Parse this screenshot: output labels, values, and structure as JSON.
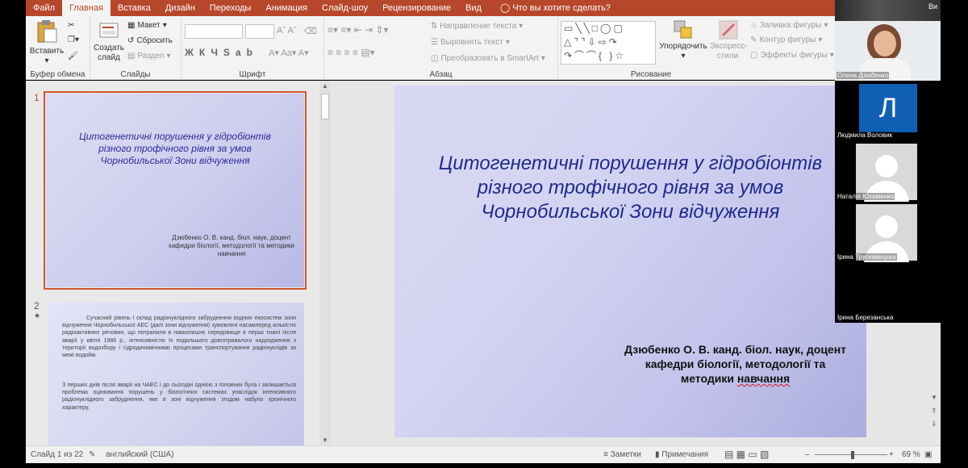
{
  "ribbon_tabs": [
    "Файл",
    "Главная",
    "Вставка",
    "Дизайн",
    "Переходы",
    "Анимация",
    "Слайд-шоу",
    "Рецензирование",
    "Вид"
  ],
  "tell_me": "Что вы хотите сделать?",
  "clipboard": {
    "paste": "Вставить",
    "label": "Буфер обмена"
  },
  "slides_group": {
    "create": "Создать",
    "slide": "слайд",
    "layout": "Макет",
    "reset": "Сбросить",
    "section": "Раздел",
    "label": "Слайды"
  },
  "font_group": {
    "label": "Шрифт",
    "format_chars": "ЖКЧSab"
  },
  "paragraph_group": {
    "text_direction": "Направление текста",
    "align_text": "Выровнять текст",
    "smartart": "Преобразовать в SmartArt",
    "label": "Абзац"
  },
  "drawing_group": {
    "arrange": "Упорядочить",
    "styles_1": "Экспресс-",
    "styles_2": "стили",
    "fill": "Заливка фигуры",
    "outline": "Контур фигуры",
    "effects": "Эффекты фигуры",
    "label": "Рисование"
  },
  "slides": [
    {
      "number": "1",
      "title": "Цитогенетичні порушення у гідробіонтів різного трофічного рівня за умов Чорнобильської Зони відчуження",
      "author": "Дзюбенко О. В. канд. біол. наук, доцент кафедри біології, методології та методики навчання"
    },
    {
      "number": "2",
      "star": "★",
      "p1": "Сучасний рівень і склад радіонуклідного забруднення водних екосистем зони відчуження Чорнобильської АЕС (далі зони відчуження) зумовлені насамперед кількістю радіоактивних речовин, що потрапили в навколишнє середовище в перші тижні після аварії у квітні 1986 р., інтенсивністю їх подальшого довготривалого надходження з території водозбору і гідродинамічними процесами транспортування радіонуклідів за межі водойм.",
      "p2": "З перших днів після аварії на ЧАЕС і до сьогодні однією з головних була і залишається проблема оцінювання порушень у біологічних системах унаслідок інтенсивного радіонуклідного забруднення, яке в зоні відчуження зтодом набуло хронічного характеру."
    }
  ],
  "main_slide": {
    "title": "Цитогенетичні порушення у гідробіонтів різного трофічного рівня за умов Чорнобильської Зони відчуження",
    "author_line1": "Дзюбенко О. В. канд. біол. наук, доцент",
    "author_line2": "кафедри біології, методології та",
    "author_line3_a": "методики ",
    "author_line3_b": "навчання"
  },
  "status": {
    "slide_count": "Слайд 1 из 22",
    "language": "английский (США)",
    "notes": "Заметки",
    "comments": "Примечания",
    "zoom": "69 %",
    "zoom_level_percent": 69
  },
  "participants": [
    {
      "name": "Олена Дзюбенко"
    },
    {
      "name": "Людмила Воловик",
      "initial": "Л"
    },
    {
      "name": "Наталія Юхименко"
    },
    {
      "name": "Ірина Трускавецька"
    },
    {
      "name": "Ірина Березанська"
    }
  ],
  "top_right_label": "Ви",
  "colors": {
    "ribbon_tab": "#b7472a",
    "selected_outline": "#d0552f",
    "slide_title": "#1e2a8c",
    "avatar_blue": "#0f5fb5"
  }
}
